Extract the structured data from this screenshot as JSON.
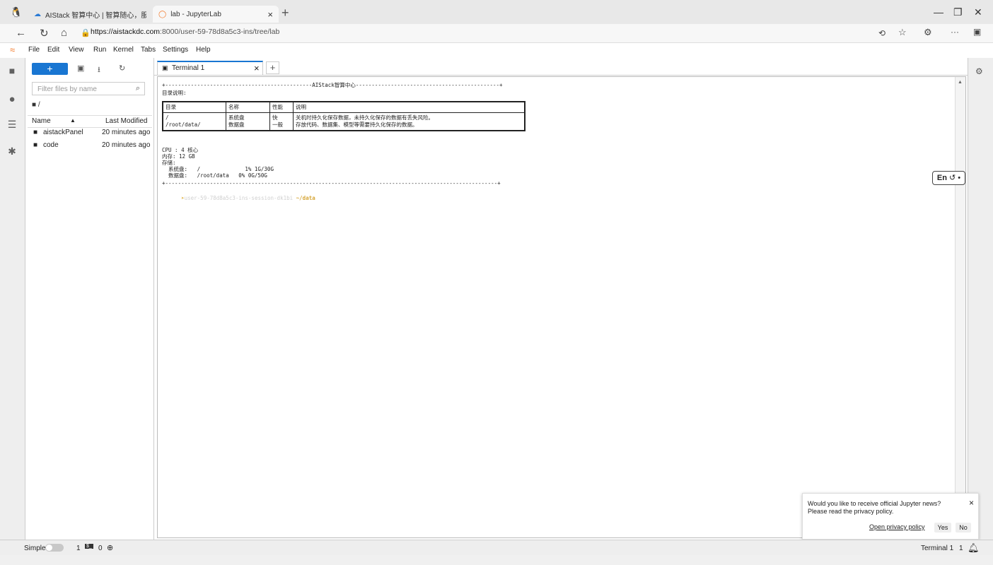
{
  "browser": {
    "tabs": [
      {
        "title": "AIStack 智算中心 | 智算随心，服务 ×",
        "active": false
      },
      {
        "title": "lab - JupyterLab",
        "active": true
      }
    ],
    "new_tab": "+",
    "url_domain": "https://aistackdc.com",
    "url_rest": ":8000/user-59-78d8a5c3-ins/tree/lab"
  },
  "menu": [
    "File",
    "Edit",
    "View",
    "Run",
    "Kernel",
    "Tabs",
    "Settings",
    "Help"
  ],
  "filebrowser": {
    "new_label": "+",
    "filter_placeholder": "Filter files by name",
    "breadcrumb": "/",
    "col_name": "Name",
    "col_modified": "Last Modified",
    "items": [
      {
        "name": "aistackPanel",
        "modified": "20 minutes ago"
      },
      {
        "name": "code",
        "modified": "20 minutes ago"
      }
    ]
  },
  "dock": {
    "tab_label": "Terminal 1",
    "close": "×",
    "add": "+"
  },
  "terminal": {
    "banner_top": "+----------------------------------------------AIStack智算中心---------------------------------------------+",
    "dir_title": "目录说明:",
    "table_head": [
      "目录",
      "名称",
      "性能",
      "说明"
    ],
    "table_rows": [
      [
        "/\n/root/data/",
        "系统盘\n数据盘",
        "快\n一般",
        "关机时持久化保存数据，未持久化保存的数据有丢失风险。\n存放代码、数据集、模型等需要持久化保存的数据。"
      ]
    ],
    "cpu": "CPU : 4 核心",
    "mem": "内存: 12 GB",
    "storage": "存储:",
    "disk1": "  系统盘:   /              1% 1G/30G",
    "disk2": "  数据盘:   /root/data   0% 0G/50G",
    "banner_bottom": "+--------------------------------------------------------------------------------------------------------+",
    "prompt_user": "user-59-78d8a5c3-ins-session-dk1bi",
    "prompt_path": "~/data"
  },
  "lang_button": "En",
  "toast": {
    "line1": "Would you like to receive official Jupyter news?",
    "line2": "Please read the privacy policy.",
    "link": "Open privacy policy",
    "yes": "Yes",
    "no": "No",
    "close": "×"
  },
  "status": {
    "mode": "Simple",
    "count1": "1",
    "count2": "0",
    "right_label": "Terminal 1",
    "right_count": "1"
  }
}
